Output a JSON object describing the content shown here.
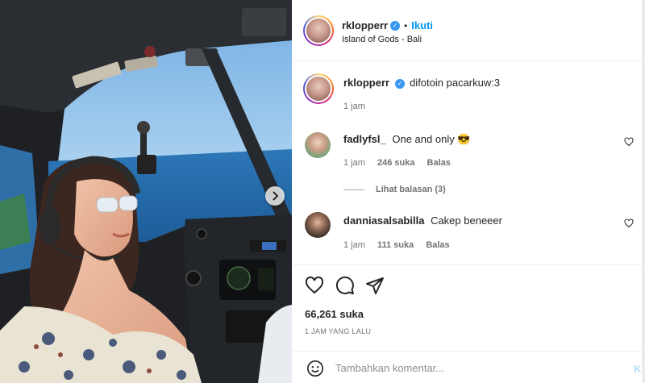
{
  "post": {
    "username": "rklopperr",
    "follow_label": "Ikuti",
    "location": "Island of Gods - Bali",
    "caption": "difotoin pacarkuw:3",
    "caption_time": "1 jam"
  },
  "comments": [
    {
      "username": "fadlyfsl_",
      "text": "One and only 😎",
      "time": "1 jam",
      "likes": "246 suka",
      "reply_label": "Balas",
      "view_replies": "Lihat balasan (3)",
      "avatar_color": "#6fa37a"
    },
    {
      "username": "danniasalsabilla",
      "text": "Cakep beneeer",
      "time": "1 jam",
      "likes": "111 suka",
      "reply_label": "Balas",
      "avatar_color": "#3b2e28"
    }
  ],
  "footer": {
    "likes_count": "66,261 suka",
    "timestamp": "1 JAM YANG LALU",
    "comment_placeholder": "Tambahkan komentar...",
    "post_label": "Kirim"
  },
  "icons": [
    "heart-icon",
    "comment-icon",
    "share-icon",
    "emoji-icon",
    "more-icon",
    "chevron-right-icon",
    "verified-icon"
  ],
  "colors": {
    "accent": "#0095f6",
    "verified": "#3897f0",
    "text": "#262626",
    "muted": "#737373"
  }
}
